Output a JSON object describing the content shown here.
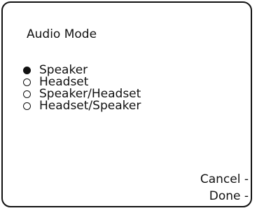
{
  "screen": {
    "title": "Audio Mode"
  },
  "options": [
    {
      "label": "Speaker",
      "selected": true
    },
    {
      "label": "Headset",
      "selected": false
    },
    {
      "label": "Speaker/Headset",
      "selected": false
    },
    {
      "label": "Headset/Speaker",
      "selected": false
    }
  ],
  "softkeys": {
    "cancel": "Cancel -",
    "done": "Done -"
  }
}
